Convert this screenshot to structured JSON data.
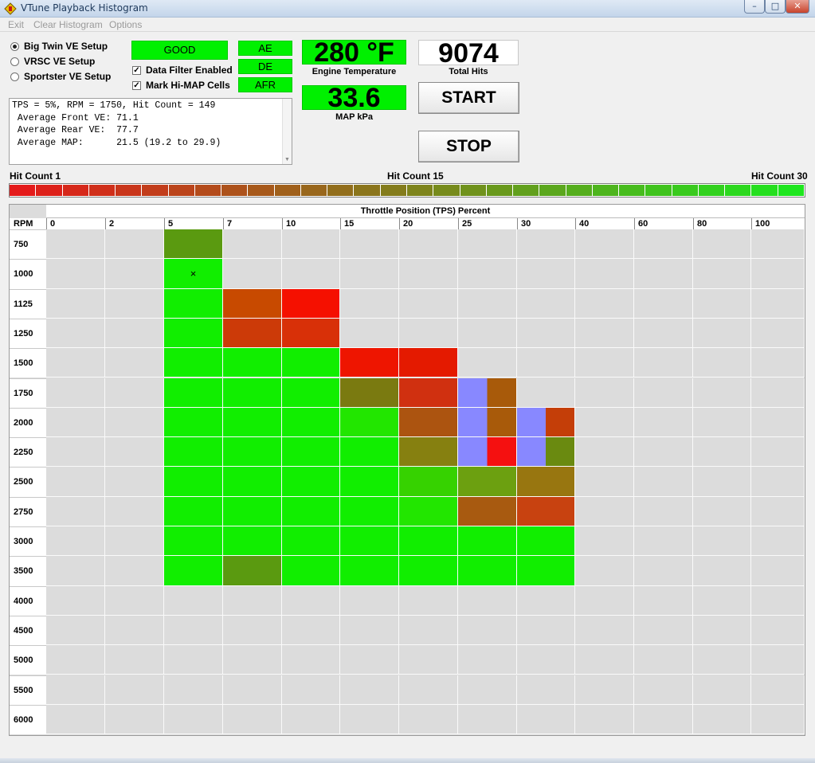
{
  "window": {
    "title": "VTune Playback Histogram",
    "controls": {
      "minimize": "–",
      "maximize": "□",
      "close": "✕"
    }
  },
  "menu": [
    "Exit",
    "Clear Histogram",
    "Options"
  ],
  "setups": [
    {
      "label": "Big Twin VE Setup",
      "selected": true
    },
    {
      "label": "VRSC VE Setup",
      "selected": false
    },
    {
      "label": "Sportster VE Setup",
      "selected": false
    }
  ],
  "status": {
    "quality": "GOOD",
    "flags": [
      "AE",
      "DE",
      "AFR"
    ],
    "data_filter": {
      "label": "Data Filter Enabled",
      "checked": true
    },
    "mark_hi_map": {
      "label": "Mark Hi-MAP Cells",
      "checked": true
    },
    "check_mark": "✓"
  },
  "readouts": {
    "engine_temp": {
      "value": "280 °F",
      "caption": "Engine Temperature"
    },
    "map": {
      "value": "33.6",
      "caption": "MAP kPa"
    },
    "total_hits": {
      "value": "9074",
      "caption": "Total Hits"
    }
  },
  "buttons": {
    "start": "START",
    "stop": "STOP"
  },
  "info": {
    "lines": [
      "TPS = 5%, RPM = 1750, Hit Count = 149",
      " Average Front VE: 71.1",
      " Average Rear VE:  77.7",
      " Average MAP:      21.5 (19.2 to 29.9)"
    ],
    "scroll_arrow": "▼"
  },
  "scale": {
    "label_min": "Hit Count 1",
    "label_mid": "Hit Count 15",
    "label_max": "Hit Count 30",
    "min_color": "#e41a1a",
    "max_color": "#1ee61e"
  },
  "histogram": {
    "title": "Throttle Position (TPS) Percent",
    "rpm_header": "RPM",
    "tps_columns": [
      "0",
      "2",
      "5",
      "7",
      "10",
      "15",
      "20",
      "25",
      "30",
      "40",
      "60",
      "80",
      "100"
    ],
    "rpm_rows": [
      "750",
      "1000",
      "1125",
      "1250",
      "1500",
      "1750",
      "2000",
      "2250",
      "2500",
      "2750",
      "3000",
      "3500",
      "4000",
      "4500",
      "5000",
      "5500",
      "6000"
    ],
    "empty_color": "#dcdcdc",
    "front_color_note": "left half / right half split cells",
    "cells": [
      {
        "rpm": "750",
        "tps": "5",
        "color": "#5a9a10"
      },
      {
        "rpm": "1000",
        "tps": "5",
        "color": "#11ee00",
        "mark": "×"
      },
      {
        "rpm": "1125",
        "tps": "5",
        "color": "#11ee00"
      },
      {
        "rpm": "1125",
        "tps": "7",
        "color": "#c84a00"
      },
      {
        "rpm": "1125",
        "tps": "10",
        "color": "#f51000"
      },
      {
        "rpm": "1250",
        "tps": "5",
        "color": "#11ee00"
      },
      {
        "rpm": "1250",
        "tps": "7",
        "color": "#cc3a08"
      },
      {
        "rpm": "1250",
        "tps": "10",
        "color": "#d83008"
      },
      {
        "rpm": "1500",
        "tps": "5",
        "color": "#11ee00"
      },
      {
        "rpm": "1500",
        "tps": "7",
        "color": "#11ee00"
      },
      {
        "rpm": "1500",
        "tps": "10",
        "color": "#11ee00"
      },
      {
        "rpm": "1500",
        "tps": "15",
        "color": "#ee1500"
      },
      {
        "rpm": "1500",
        "tps": "20",
        "color": "#e41a00"
      },
      {
        "rpm": "1750",
        "tps": "5",
        "color": "#11ee00"
      },
      {
        "rpm": "1750",
        "tps": "7",
        "color": "#11ee00"
      },
      {
        "rpm": "1750",
        "tps": "10",
        "color": "#11ee00"
      },
      {
        "rpm": "1750",
        "tps": "15",
        "color": "#7a7a10"
      },
      {
        "rpm": "1750",
        "tps": "20",
        "color": "#d03010"
      },
      {
        "rpm": "1750",
        "tps": "25",
        "split": [
          "#8888ff",
          "#a85a0a"
        ]
      },
      {
        "rpm": "2000",
        "tps": "5",
        "color": "#11ee00"
      },
      {
        "rpm": "2000",
        "tps": "7",
        "color": "#11ee00"
      },
      {
        "rpm": "2000",
        "tps": "10",
        "color": "#11ee00"
      },
      {
        "rpm": "2000",
        "tps": "15",
        "color": "#22e600"
      },
      {
        "rpm": "2000",
        "tps": "20",
        "color": "#ac5410"
      },
      {
        "rpm": "2000",
        "tps": "25",
        "split": [
          "#8888ff",
          "#a85a0a"
        ]
      },
      {
        "rpm": "2000",
        "tps": "30",
        "split": [
          "#8888ff",
          "#c43e08"
        ]
      },
      {
        "rpm": "2250",
        "tps": "5",
        "color": "#11ee00"
      },
      {
        "rpm": "2250",
        "tps": "7",
        "color": "#11ee00"
      },
      {
        "rpm": "2250",
        "tps": "10",
        "color": "#11ee00"
      },
      {
        "rpm": "2250",
        "tps": "15",
        "color": "#11ee00"
      },
      {
        "rpm": "2250",
        "tps": "20",
        "color": "#868010"
      },
      {
        "rpm": "2250",
        "tps": "25",
        "split": [
          "#8888ff",
          "#f51010"
        ]
      },
      {
        "rpm": "2250",
        "tps": "30",
        "split": [
          "#8888ff",
          "#6a8a10"
        ]
      },
      {
        "rpm": "2500",
        "tps": "5",
        "color": "#11ee00"
      },
      {
        "rpm": "2500",
        "tps": "7",
        "color": "#11ee00"
      },
      {
        "rpm": "2500",
        "tps": "10",
        "color": "#11ee00"
      },
      {
        "rpm": "2500",
        "tps": "15",
        "color": "#11ee00"
      },
      {
        "rpm": "2500",
        "tps": "20",
        "color": "#36d200"
      },
      {
        "rpm": "2500",
        "tps": "25",
        "color": "#6ca010"
      },
      {
        "rpm": "2500",
        "tps": "30",
        "color": "#987610"
      },
      {
        "rpm": "2750",
        "tps": "5",
        "color": "#11ee00"
      },
      {
        "rpm": "2750",
        "tps": "7",
        "color": "#11ee00"
      },
      {
        "rpm": "2750",
        "tps": "10",
        "color": "#11ee00"
      },
      {
        "rpm": "2750",
        "tps": "15",
        "color": "#11ee00"
      },
      {
        "rpm": "2750",
        "tps": "20",
        "color": "#22e600"
      },
      {
        "rpm": "2750",
        "tps": "25",
        "color": "#a85a10"
      },
      {
        "rpm": "2750",
        "tps": "30",
        "color": "#c84210"
      },
      {
        "rpm": "3000",
        "tps": "5",
        "color": "#11ee00"
      },
      {
        "rpm": "3000",
        "tps": "7",
        "color": "#11ee00"
      },
      {
        "rpm": "3000",
        "tps": "10",
        "color": "#11ee00"
      },
      {
        "rpm": "3000",
        "tps": "15",
        "color": "#11ee00"
      },
      {
        "rpm": "3000",
        "tps": "20",
        "color": "#11ee00"
      },
      {
        "rpm": "3000",
        "tps": "25",
        "color": "#11ee00"
      },
      {
        "rpm": "3000",
        "tps": "30",
        "color": "#11ee00"
      },
      {
        "rpm": "3500",
        "tps": "5",
        "color": "#11ee00"
      },
      {
        "rpm": "3500",
        "tps": "7",
        "color": "#5a9a10"
      },
      {
        "rpm": "3500",
        "tps": "10",
        "color": "#11ee00"
      },
      {
        "rpm": "3500",
        "tps": "15",
        "color": "#11ee00"
      },
      {
        "rpm": "3500",
        "tps": "20",
        "color": "#11ee00"
      },
      {
        "rpm": "3500",
        "tps": "25",
        "color": "#11ee00"
      },
      {
        "rpm": "3500",
        "tps": "30",
        "color": "#11ee00"
      }
    ]
  }
}
